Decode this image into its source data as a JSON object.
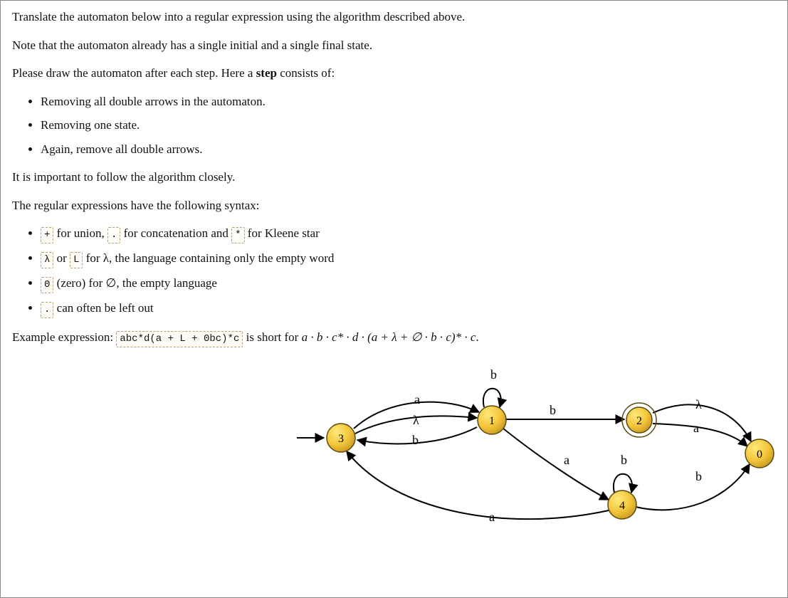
{
  "intro": {
    "line1": "Translate the automaton below into a regular expression using the algorithm described above.",
    "line2": "Note that the automaton already has a single initial and a single final state.",
    "line3_a": "Please draw the automaton after each step. Here a ",
    "line3_b": "step",
    "line3_c": " consists of:"
  },
  "steps": {
    "s1": "Removing all double arrows in the automaton.",
    "s2": "Removing one state.",
    "s3": "Again, remove all double arrows."
  },
  "follow": "It is important to follow the algorithm closely.",
  "syntax_intro": "The regular expressions have the following syntax:",
  "syntax": {
    "plus": "+",
    "dot": ".",
    "star": "*",
    "lambda": "λ",
    "L": "L",
    "zero": "0",
    "dot2": ".",
    "row1_a": " for union, ",
    "row1_b": " for concatenation and ",
    "row1_c": " for Kleene star",
    "row2_a": " or ",
    "row2_b": " for λ, the language containing only the empty word",
    "row3_a": " (zero) for ∅, the empty language",
    "row4_a": " can often be left out"
  },
  "example": {
    "label": "Example expression: ",
    "code": "abc*d(a + L + 0bc)*c",
    "explain_a": " is short for ",
    "explain_b": "a · b · c* · d · (a + λ + ∅ · b · c)* · c",
    "explain_c": "."
  },
  "automaton": {
    "states": {
      "s0": "0",
      "s1": "1",
      "s2": "2",
      "s3": "3",
      "s4": "4"
    },
    "labels": {
      "a": "a",
      "b": "b",
      "lambda": "λ"
    }
  }
}
